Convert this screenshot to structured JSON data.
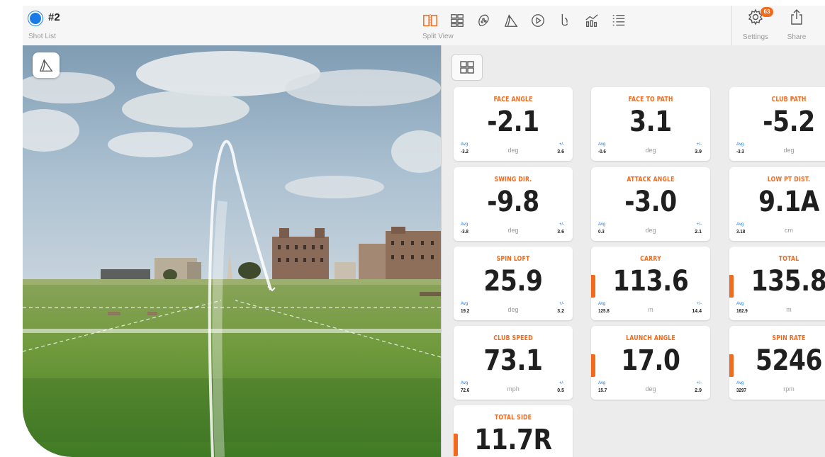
{
  "header": {
    "shot_number": "#2",
    "shot_list_label": "Shot List",
    "split_view_label": "Split View",
    "settings_label": "Settings",
    "settings_badge": "63",
    "share_label": "Share"
  },
  "toolbar_icons": [
    "split-view-icon",
    "grid-view-icon",
    "club-icon",
    "trajectory-icon",
    "play-icon",
    "swing-icon",
    "stats-icon",
    "list-icon"
  ],
  "colors": {
    "accent": "#f26b1d",
    "blue": "#1a7be6"
  },
  "tiles": [
    {
      "label": "FACE ANGLE",
      "value": "-2.1",
      "unit": "deg",
      "avg_label": "Avg",
      "avg": "-3.2",
      "pm_label": "+/-",
      "pm": "3.6",
      "marker": false
    },
    {
      "label": "FACE TO PATH",
      "value": "3.1",
      "unit": "deg",
      "avg_label": "Avg",
      "avg": "-0.6",
      "pm_label": "+/-",
      "pm": "3.9",
      "marker": false
    },
    {
      "label": "CLUB PATH",
      "value": "-5.2",
      "unit": "deg",
      "avg_label": "Avg",
      "avg": "-3.3",
      "pm_label": "",
      "pm": "",
      "marker": false
    },
    {
      "label": "SWING DIR.",
      "value": "-9.8",
      "unit": "deg",
      "avg_label": "Avg",
      "avg": "-3.8",
      "pm_label": "+/-",
      "pm": "3.6",
      "marker": false
    },
    {
      "label": "ATTACK ANGLE",
      "value": "-3.0",
      "unit": "deg",
      "avg_label": "Avg",
      "avg": "0.3",
      "pm_label": "+/-",
      "pm": "2.1",
      "marker": false
    },
    {
      "label": "LOW PT DIST.",
      "value": "9.1A",
      "unit": "cm",
      "avg_label": "Avg",
      "avg": "3.18",
      "pm_label": "",
      "pm": "",
      "marker": false
    },
    {
      "label": "SPIN LOFT",
      "value": "25.9",
      "unit": "deg",
      "avg_label": "Avg",
      "avg": "19.2",
      "pm_label": "+/-",
      "pm": "3.2",
      "marker": false
    },
    {
      "label": "CARRY",
      "value": "113.6",
      "unit": "m",
      "avg_label": "Avg",
      "avg": "125.8",
      "pm_label": "+/-",
      "pm": "14.4",
      "marker": true
    },
    {
      "label": "TOTAL",
      "value": "135.8",
      "unit": "m",
      "avg_label": "Avg",
      "avg": "162.9",
      "pm_label": "",
      "pm": "",
      "marker": true
    },
    {
      "label": "CLUB SPEED",
      "value": "73.1",
      "unit": "mph",
      "avg_label": "Avg",
      "avg": "72.6",
      "pm_label": "+/-",
      "pm": "0.5",
      "marker": false
    },
    {
      "label": "LAUNCH ANGLE",
      "value": "17.0",
      "unit": "deg",
      "avg_label": "Avg",
      "avg": "15.7",
      "pm_label": "+/-",
      "pm": "2.9",
      "marker": true
    },
    {
      "label": "SPIN RATE",
      "value": "5246",
      "unit": "rpm",
      "avg_label": "Avg",
      "avg": "3297",
      "pm_label": "",
      "pm": "",
      "marker": true
    },
    {
      "label": "TOTAL SIDE",
      "value": "11.7R",
      "unit": "",
      "avg_label": "",
      "avg": "",
      "pm_label": "",
      "pm": "",
      "marker": true
    }
  ]
}
